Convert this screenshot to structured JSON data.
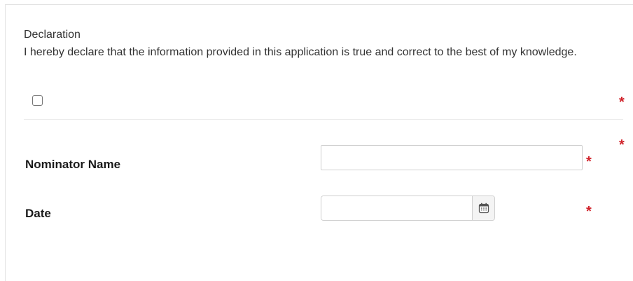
{
  "declaration": {
    "title": "Declaration",
    "text": "I hereby declare that the information provided in this application is true and correct to the best of my knowledge.",
    "checked": false,
    "required_marker": "*"
  },
  "fields": {
    "nominator": {
      "label": "Nominator Name",
      "value": "",
      "placeholder": "",
      "required_marker": "*"
    },
    "date": {
      "label": "Date",
      "value": "",
      "placeholder": "",
      "icon": "calendar-icon",
      "required_marker": "*"
    }
  },
  "colors": {
    "required": "#d0222a",
    "border": "#cfcfcf",
    "text": "#333333"
  }
}
